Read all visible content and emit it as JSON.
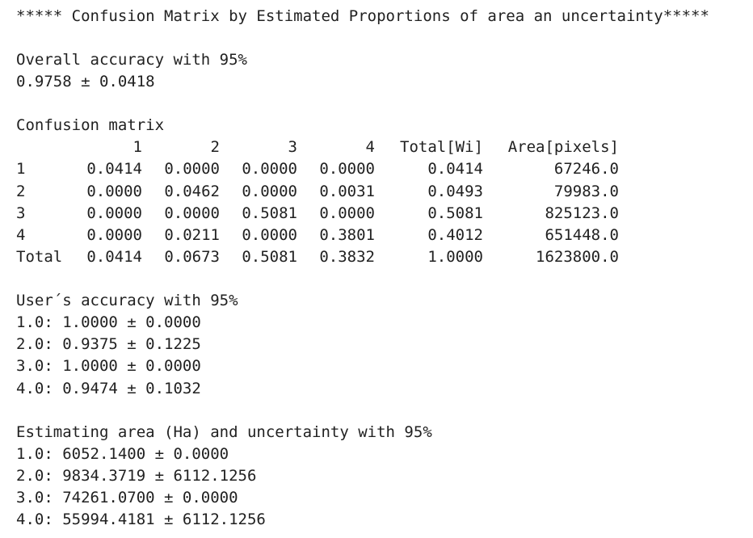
{
  "title": "***** Confusion Matrix by Estimated Proportions of area an uncertainty*****",
  "overall": {
    "heading": "Overall accuracy with 95%",
    "value": "0.9758 ± 0.0418"
  },
  "confusion": {
    "heading": "Confusion matrix",
    "columns": [
      "1",
      "2",
      "3",
      "4",
      "Total[Wi]",
      "Area[pixels]"
    ],
    "rows": [
      {
        "label": "1",
        "cells": [
          "0.0414",
          "0.0000",
          "0.0000",
          "0.0000",
          "0.0414",
          "67246.0"
        ]
      },
      {
        "label": "2",
        "cells": [
          "0.0000",
          "0.0462",
          "0.0000",
          "0.0031",
          "0.0493",
          "79983.0"
        ]
      },
      {
        "label": "3",
        "cells": [
          "0.0000",
          "0.0000",
          "0.5081",
          "0.0000",
          "0.5081",
          "825123.0"
        ]
      },
      {
        "label": "4",
        "cells": [
          "0.0000",
          "0.0211",
          "0.0000",
          "0.3801",
          "0.4012",
          "651448.0"
        ]
      },
      {
        "label": "Total",
        "cells": [
          "0.0414",
          "0.0673",
          "0.5081",
          "0.3832",
          "1.0000",
          "1623800.0"
        ]
      }
    ]
  },
  "users_accuracy": {
    "heading": "User´s accuracy with 95%",
    "items": [
      "1.0: 1.0000 ± 0.0000",
      "2.0: 0.9375 ± 0.1225",
      "3.0: 1.0000 ± 0.0000",
      "4.0: 0.9474 ± 0.1032"
    ]
  },
  "area": {
    "heading": "Estimating area (Ha) and uncertainty with 95%",
    "items": [
      "1.0: 6052.1400 ± 0.0000",
      "2.0: 9834.3719 ± 6112.1256",
      "3.0: 74261.0700 ± 0.0000",
      "4.0: 55994.4181 ± 6112.1256"
    ]
  }
}
